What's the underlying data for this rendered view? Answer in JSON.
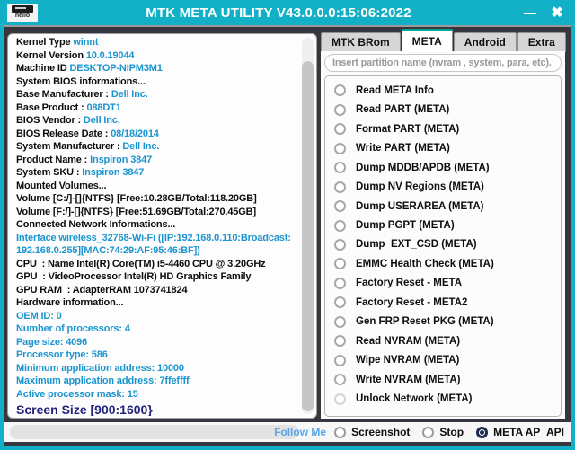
{
  "window": {
    "title": "MTK META UTILITY V43.0.0.0:15:06:2022",
    "icon_label": "helio",
    "icons": {
      "minimize": "—",
      "close": "✖"
    }
  },
  "colors": {
    "titlebar": "#12b0c6",
    "window_border": "#12b0c6",
    "content_bg": "#36363e",
    "tab_accent": "#00a693",
    "log_value_blue": "#1b95d0",
    "screen_size_navy": "#23237d",
    "follow_link_blue": "#58a6e8",
    "checked_radio_navy": "#1c2a4e"
  },
  "log": {
    "lines": [
      {
        "segs": [
          {
            "t": "Kernel Type ",
            "c": "k"
          },
          {
            "t": "winnt",
            "c": "v"
          }
        ]
      },
      {
        "segs": [
          {
            "t": "Kernel Version ",
            "c": "k"
          },
          {
            "t": "10.0.19044",
            "c": "v"
          }
        ]
      },
      {
        "segs": [
          {
            "t": "Machine ID ",
            "c": "k"
          },
          {
            "t": "DESKTOP-NIPM3M1",
            "c": "v"
          }
        ]
      },
      {
        "segs": [
          {
            "t": "System BIOS informations...",
            "c": "k"
          }
        ]
      },
      {
        "segs": [
          {
            "t": "Base Manufacturer : ",
            "c": "k"
          },
          {
            "t": "Dell Inc.",
            "c": "v"
          }
        ]
      },
      {
        "segs": [
          {
            "t": "Base Product : ",
            "c": "k"
          },
          {
            "t": "088DT1",
            "c": "v"
          }
        ]
      },
      {
        "segs": [
          {
            "t": "BIOS Vendor : ",
            "c": "k"
          },
          {
            "t": "Dell Inc.",
            "c": "v"
          }
        ]
      },
      {
        "segs": [
          {
            "t": "BIOS Release Date : ",
            "c": "k"
          },
          {
            "t": "08/18/2014",
            "c": "v"
          }
        ]
      },
      {
        "segs": [
          {
            "t": "System Manufacturer : ",
            "c": "k"
          },
          {
            "t": "Dell Inc.",
            "c": "v"
          }
        ]
      },
      {
        "segs": [
          {
            "t": "Product Name : ",
            "c": "k"
          },
          {
            "t": "Inspiron 3847",
            "c": "v"
          }
        ]
      },
      {
        "segs": [
          {
            "t": "System SKU : ",
            "c": "k"
          },
          {
            "t": "Inspiron 3847",
            "c": "v"
          }
        ]
      },
      {
        "segs": [
          {
            "t": "Mounted Volumes...",
            "c": "k"
          }
        ]
      },
      {
        "segs": [
          {
            "t": "Volume [C:/]-[]{NTFS} [Free:10.28GB/Total:118.20GB]",
            "c": "k"
          }
        ]
      },
      {
        "segs": [
          {
            "t": "Volume [F:/]-[]{NTFS} [Free:51.69GB/Total:270.45GB]",
            "c": "k"
          }
        ]
      },
      {
        "segs": [
          {
            "t": "Connected Network Informations...",
            "c": "k"
          }
        ]
      },
      {
        "segs": [
          {
            "t": "Interface wireless_32768-Wi-Fi ([IP:192.168.0.110:Broadcast:",
            "c": "v"
          }
        ]
      },
      {
        "segs": [
          {
            "t": "192.168.0.255][MAC:74:29:AF:95:46:BF])",
            "c": "v"
          }
        ]
      },
      {
        "segs": [
          {
            "t": "CPU  : Name Intel(R) Core(TM) i5-4460 CPU @ 3.20GHz",
            "c": "k"
          }
        ]
      },
      {
        "segs": [
          {
            "t": "GPU  : VideoProcessor Intel(R) HD Graphics Family",
            "c": "k"
          }
        ]
      },
      {
        "segs": [
          {
            "t": "GPU RAM  : AdapterRAM 1073741824",
            "c": "k"
          }
        ]
      },
      {
        "segs": [
          {
            "t": "Hardware information...",
            "c": "k"
          }
        ]
      },
      {
        "segs": [
          {
            "t": "OEM ID: 0",
            "c": "v"
          }
        ]
      },
      {
        "segs": [
          {
            "t": "Number of processors: 4",
            "c": "v"
          }
        ]
      },
      {
        "segs": [
          {
            "t": "Page size: 4096",
            "c": "v"
          }
        ]
      },
      {
        "segs": [
          {
            "t": "Processor type: 586",
            "c": "v"
          }
        ]
      },
      {
        "segs": [
          {
            "t": "Minimum application address: 10000",
            "c": "v"
          }
        ]
      },
      {
        "segs": [
          {
            "t": "Maximum application address: 7ffeffff",
            "c": "v"
          }
        ]
      },
      {
        "segs": [
          {
            "t": "Active processor mask: 15",
            "c": "v"
          }
        ]
      },
      {
        "variant": "screen-size",
        "segs": [
          {
            "t": "Screen Size [900:1600}",
            "c": "s"
          }
        ]
      }
    ]
  },
  "tabs": {
    "items": [
      {
        "label": "MTK BRom",
        "active": false
      },
      {
        "label": "META",
        "active": true
      },
      {
        "label": "Android",
        "active": false
      },
      {
        "label": "Extra",
        "active": false
      }
    ]
  },
  "partition_input": {
    "placeholder": "Insert partition name (nvram , system, para, etc)."
  },
  "meta_actions": [
    {
      "label": "Read META Info",
      "disabled": false
    },
    {
      "label": "Read PART (META)",
      "disabled": false
    },
    {
      "label": "Format PART (META)",
      "disabled": false
    },
    {
      "label": "Write PART (META)",
      "disabled": false
    },
    {
      "label": "Dump MDDB/APDB (META)",
      "disabled": false
    },
    {
      "label": "Dump NV Regions (META)",
      "disabled": false
    },
    {
      "label": "Dump USERAREA (META)",
      "disabled": false
    },
    {
      "label": "Dump PGPT (META)",
      "disabled": false
    },
    {
      "label": "Dump  EXT_CSD (META)",
      "disabled": false
    },
    {
      "label": "EMMC Health Check (META)",
      "disabled": false
    },
    {
      "label": "Factory Reset - META",
      "disabled": false
    },
    {
      "label": "Factory Reset - META2",
      "disabled": false
    },
    {
      "label": "Gen FRP Reset PKG (META)",
      "disabled": false
    },
    {
      "label": "Read NVRAM (META)",
      "disabled": false
    },
    {
      "label": "Wipe NVRAM (META)",
      "disabled": false
    },
    {
      "label": "Write NVRAM (META)",
      "disabled": false
    },
    {
      "label": "Unlock Network (META)",
      "disabled": true
    }
  ],
  "bottom": {
    "follow_label": "Follow Me",
    "radios": [
      {
        "label": "Screenshot",
        "checked": false
      },
      {
        "label": "Stop",
        "checked": false
      },
      {
        "label": "META AP_API",
        "checked": true
      }
    ]
  }
}
